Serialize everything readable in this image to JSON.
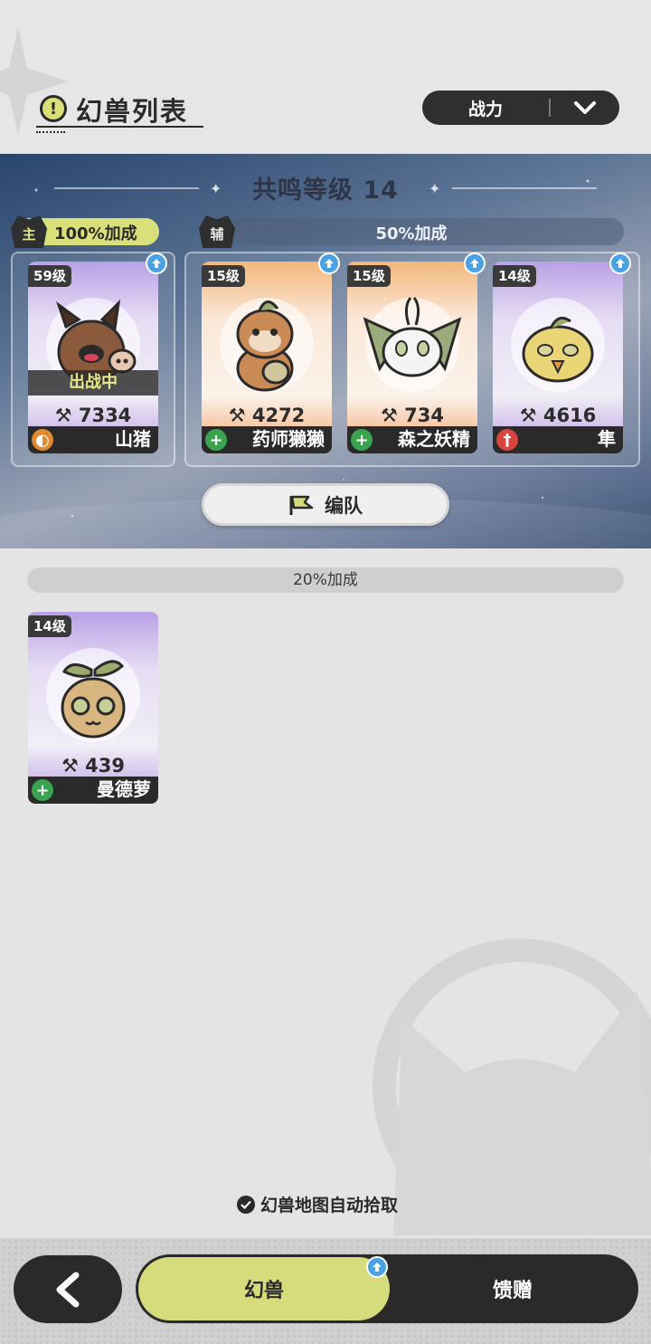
{
  "header": {
    "title": "幻兽列表",
    "title_icon": "!",
    "sort": {
      "label": "战力"
    }
  },
  "team": {
    "resonance_label": "共鸣等级 14",
    "main_badge": "主",
    "main_bonus": "100%加成",
    "sub_badge": "辅",
    "sub_bonus": "50%加成",
    "formation_label": "编队",
    "main_card": {
      "level": "59级",
      "status": "出战中",
      "power": "7334",
      "name": "山猪",
      "role": "tank-icon",
      "theme": "purple"
    },
    "sub_cards": [
      {
        "level": "15级",
        "power": "4272",
        "name": "药师獭獭",
        "role": "heal-icon",
        "theme": "orange"
      },
      {
        "level": "15级",
        "power": "734",
        "name": "森之妖精",
        "role": "heal-icon",
        "theme": "orange"
      },
      {
        "level": "14级",
        "power": "4616",
        "name": "隼",
        "role": "attack-icon",
        "theme": "purple"
      }
    ]
  },
  "reserve": {
    "bonus": "20%加成",
    "cards": [
      {
        "level": "14级",
        "power": "439",
        "name": "曼德萝",
        "role": "heal-icon",
        "theme": "purple"
      }
    ]
  },
  "auto_pickup_label": "幻兽地图自动拾取",
  "nav": {
    "tab_beasts": "幻兽",
    "tab_gift": "馈赠"
  },
  "colors": {
    "accent": "#d6dc7c",
    "dark": "#2a2a2a",
    "upgrade": "#4aa2e6",
    "heal": "#3aa34e",
    "tank": "#e0892f",
    "attack": "#d8453e"
  }
}
